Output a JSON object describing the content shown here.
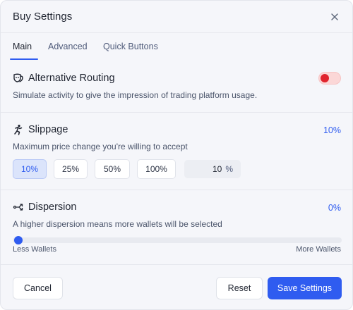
{
  "dialog": {
    "title": "Buy Settings"
  },
  "tabs": [
    {
      "label": "Main",
      "active": true
    },
    {
      "label": "Advanced",
      "active": false
    },
    {
      "label": "Quick Buttons",
      "active": false
    }
  ],
  "routing": {
    "title": "Alternative Routing",
    "description": "Simulate activity to give the impression of trading platform usage.",
    "enabled": false,
    "icon": "mask-icon"
  },
  "slippage": {
    "title": "Slippage",
    "value": "10%",
    "description": "Maximum price change you're willing to accept",
    "icon": "runner-icon",
    "presets": [
      {
        "label": "10%",
        "active": true
      },
      {
        "label": "25%",
        "active": false
      },
      {
        "label": "50%",
        "active": false
      },
      {
        "label": "100%",
        "active": false
      }
    ],
    "custom_value": "10",
    "custom_unit": "%"
  },
  "dispersion": {
    "title": "Dispersion",
    "value": "0%",
    "description": "A higher dispersion means more wallets will be selected",
    "icon": "share-nodes-icon",
    "level": 0,
    "min_label": "Less Wallets",
    "max_label": "More Wallets"
  },
  "footer": {
    "cancel_label": "Cancel",
    "reset_label": "Reset",
    "save_label": "Save Settings"
  },
  "colors": {
    "accent": "#2f5cf0",
    "toggle_off": "#e0242e"
  }
}
